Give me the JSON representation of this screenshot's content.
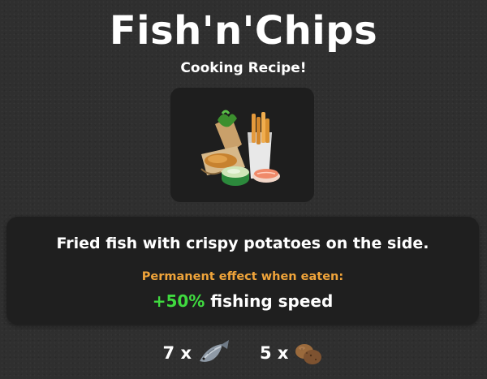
{
  "recipe": {
    "title": "Fish'n'Chips",
    "subtitle": "Cooking Recipe!",
    "description": "Fried fish with crispy potatoes on the side.",
    "effect_label": "Permanent effect when eaten:",
    "effect_value": "+50%",
    "effect_text": "fishing speed"
  },
  "ingredients": [
    {
      "quantity": "7 x",
      "icon": "fish-icon"
    },
    {
      "quantity": "5 x",
      "icon": "potato-icon"
    }
  ],
  "colors": {
    "background": "#2f2f2f",
    "panel": "#1f1f1f",
    "effect_label": "#f0a43a",
    "effect_value": "#3fd93f"
  }
}
